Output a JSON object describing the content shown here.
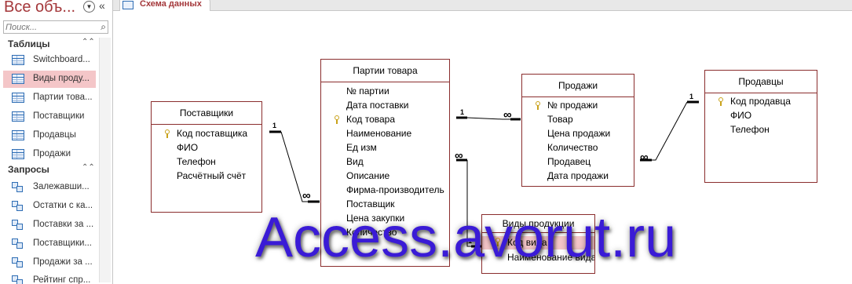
{
  "nav": {
    "title": "Все объ...",
    "search_placeholder": "Поиск...",
    "groups": {
      "tables": {
        "label": "Таблицы",
        "items": [
          "Switchboard...",
          "Виды проду...",
          "Партии това...",
          "Поставщики",
          "Продавцы",
          "Продажи"
        ]
      },
      "queries": {
        "label": "Запросы",
        "items": [
          "Залежавши...",
          "Остатки с ка...",
          "Поставки за ...",
          "Поставщики...",
          "Продажи за ...",
          "Рейтинг спр..."
        ]
      }
    },
    "selected_item": "Виды проду..."
  },
  "tab": {
    "label": "Схема данных",
    "icon": "relationships-icon"
  },
  "diagram": {
    "tables": {
      "suppliers": {
        "title": "Поставщики",
        "fields": [
          "Код поставщика",
          "ФИО",
          "Телефон",
          "Расчётный счёт"
        ],
        "key_field": "Код поставщика"
      },
      "batches": {
        "title": "Партии товара",
        "fields": [
          "№ партии",
          "Дата поставки",
          "Код товара",
          "Наименование",
          "Ед изм",
          "Вид",
          "Описание",
          "Фирма-производитель",
          "Поставщик",
          "Цена закупки",
          "Количество"
        ],
        "key_field": "Код товара"
      },
      "sales": {
        "title": "Продажи",
        "fields": [
          "№ продажи",
          "Товар",
          "Цена продажи",
          "Количество",
          "Продавец",
          "Дата продажи"
        ],
        "key_field": "№ продажи"
      },
      "sellers": {
        "title": "Продавцы",
        "fields": [
          "Код продавца",
          "ФИО",
          "Телефон"
        ],
        "key_field": "Код продавца"
      },
      "product_types": {
        "title": "Виды продукции",
        "fields": [
          "Код вида",
          "Наименование вида"
        ],
        "key_field": "Код вида"
      }
    },
    "relations": [
      {
        "from": "Поставщики.Код поставщика",
        "to": "Партии товара.Поставщик",
        "one": "1",
        "many": "∞"
      },
      {
        "from": "Партии товара.Код товара",
        "to": "Продажи.Товар",
        "one": "1",
        "many": "∞"
      },
      {
        "from": "Продавцы.Код продавца",
        "to": "Продажи.Продавец",
        "one": "1",
        "many": "∞"
      },
      {
        "from": "Виды продукции.Код вида",
        "to": "Партии товара.Вид",
        "one": "1",
        "many": "∞"
      }
    ]
  },
  "watermark": "Access.avorut.ru",
  "colors": {
    "accent": "#a4373a",
    "table_border": "#8a2d2d",
    "selection": "#f4c6c8",
    "watermark": "#3a1bd6"
  }
}
